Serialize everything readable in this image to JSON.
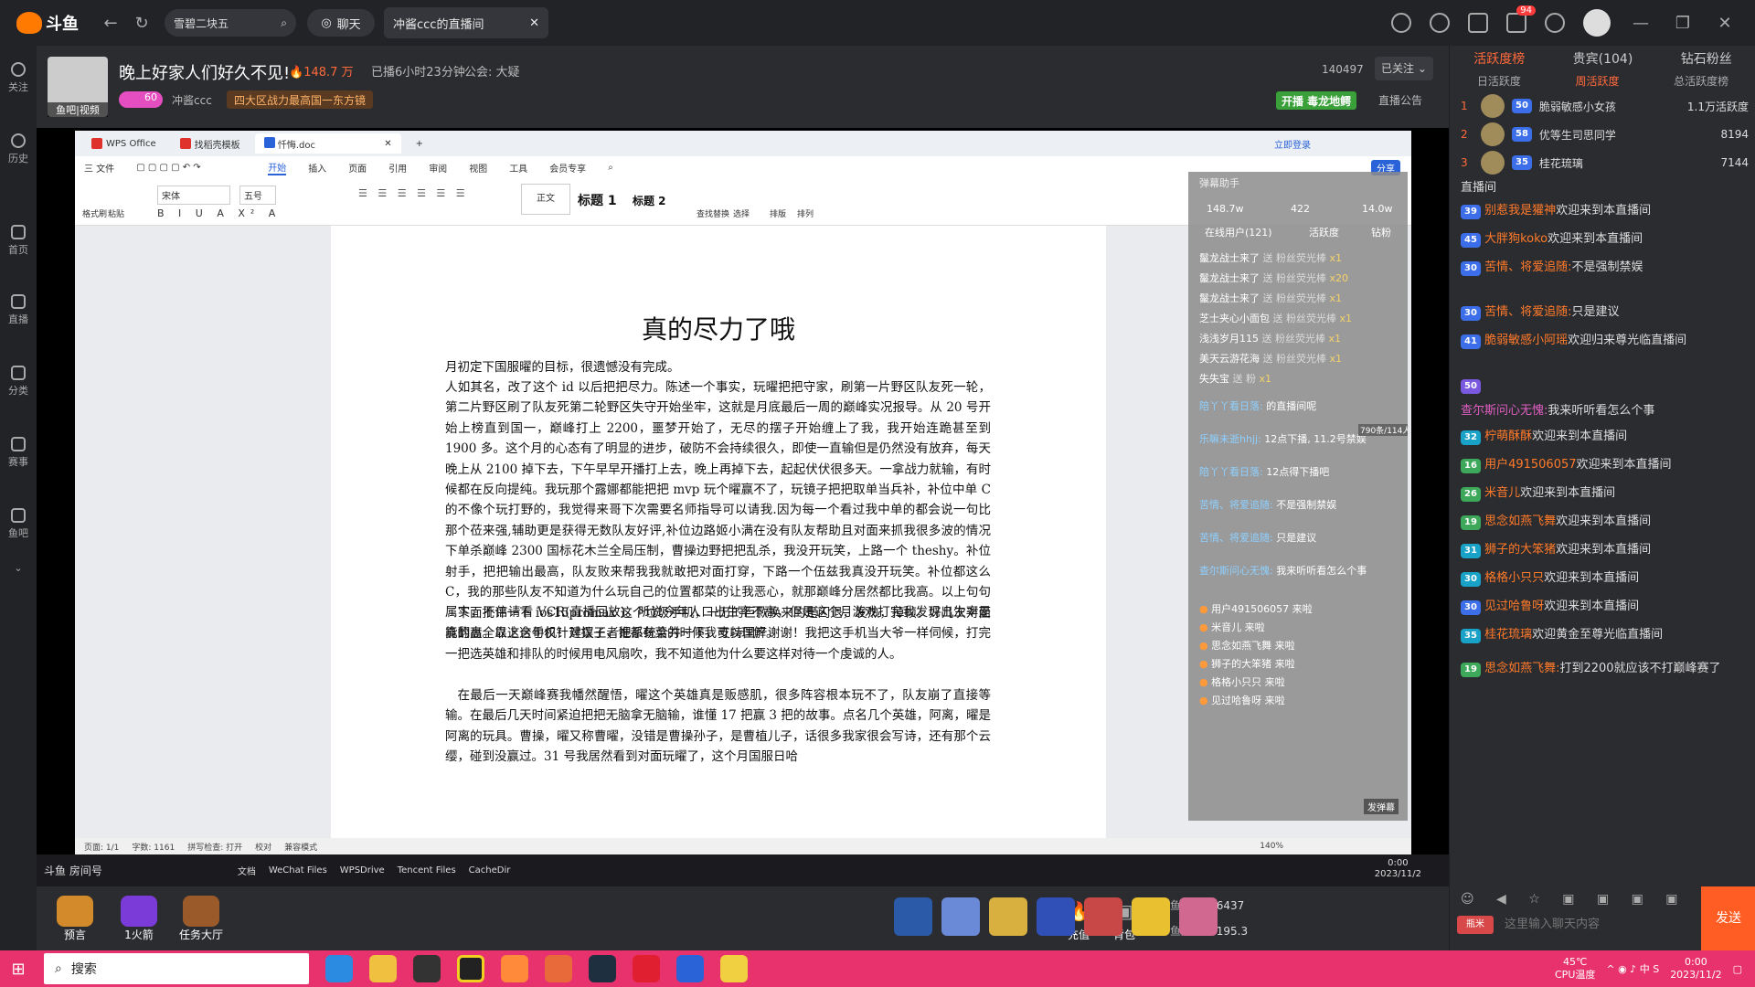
{
  "topbar": {
    "logo": "斗鱼",
    "search_text": "雪碧二块五",
    "chat_label": "聊天",
    "room_tab": "冲酱ccc的直播间",
    "notif_count": "94"
  },
  "sidebar": [
    {
      "label": "关注",
      "icon": "heart-icon"
    },
    {
      "label": "历史",
      "icon": "clock-icon"
    },
    {
      "label": "首页",
      "icon": "home-icon"
    },
    {
      "label": "直播",
      "icon": "tv-icon"
    },
    {
      "label": "分类",
      "icon": "grid-icon"
    },
    {
      "label": "赛事",
      "icon": "trophy-icon"
    },
    {
      "label": "鱼吧",
      "icon": "fishbar-icon"
    }
  ],
  "room": {
    "avatar_tag": "鱼吧|视频",
    "title": "晚上好家人们好久不见!",
    "heat": "148.7 万",
    "uptime": "已播6小时23分钟",
    "guild": "公会: 大疑",
    "fan_level": "60",
    "streamer": "冲酱ccc",
    "rank_banner": "四大区战力最高国一东方镜",
    "viewer_id": "140497",
    "follow_label": "已关注",
    "open_badge": "开播 毒龙地鳄",
    "notice": "直播公告"
  },
  "wps": {
    "tabs": [
      "WPS Office",
      "找稻壳模板",
      "忏悔.doc"
    ],
    "login": "立即登录",
    "share": "分享",
    "menu": [
      "三 文件",
      "开始",
      "插入",
      "页面",
      "引用",
      "审阅",
      "视图",
      "工具",
      "会员专享"
    ],
    "font_name": "宋体",
    "font_size": "五号",
    "styles": [
      "正文",
      "标题 1",
      "标题 2"
    ],
    "tools": [
      "查找替换",
      "选择",
      "排版",
      "排列"
    ],
    "left_tools": [
      "格式刷",
      "粘贴"
    ],
    "doc_title": "真的尽力了哦",
    "paragraphs": [
      "月初定下国服曜的目标，很遗憾没有完成。",
      "人如其名，改了这个 id 以后把把尽力。陈述一个事实，玩曜把把守家，刷第一片野区队友死一轮，第二片野区刷了队友死第二轮野区失守开始坐牢，这就是月底最后一周的巅峰实况报导。从 20 号开始上榜直到国一，巅峰打上 2200，噩梦开始了，无尽的摆子开始缠上了我，我开始连跪甚至到 1900 多。这个月的心态有了明显的进步，破防不会持续很久，即使一直输但是仍然没有放弃，每天晚上从 2100 掉下去，下午早早开播打上去，晚上再掉下去，起起伏伏很多天。一拿战力就输，有时候都在反向提纯。我玩那个露娜都能把把 mvp 玩个曜赢不了，玩镜子把把取单当兵补，补位中单 C 的不像个玩打野的，我觉得来哥下次需要名师指导可以请我.因为每一个看过我中单的都会说一句比那个莅来强,辅助更是获得无数队友好评,补位边路姬小满在没有队友帮助且对面来抓我很多波的情况下单杀巅峰 2300 国标花木兰全局压制，曹操边野把把乱杀，我没开玩笑，上路一个 theshy。补位射手，把把输出最高，队友败来帮我我就敢把对面打穿，下路一个伍兹我真没开玩笑。补位都这么 C，我的那些队友不知道为什么玩自己的位置都菜的让我恶心，就那巅峰分居然都比我高。以上句句属实，不信请看 VCR(直播回放)。听说今年人口出生率不高，但是这个月游戏打完我发现出生率是真的高。以上这句仅针对摆子，谁都有菜的时候我可以理解。",
      "下面批评一下 ios15promax 这个垃圾手机，一万的巨款换来的是闪退，发热，掉帧。好几次对面能翻盘全靠这台手机！建议王者把系统合并一下，支持国产谢谢！我把这手机当大爷一样伺候，打完一把选英雄和排队的时候用电风扇吹，我不知道他为什么要这样对待一个虔诚的人。",
      "在最后一天巅峰赛我幡然醒悟，曜这个英雄真是贩感肌，很多阵容根本玩不了，队友崩了直接等输。在最后几天时间紧迫把把无脑拿无脑输，谁懂 17 把赢 3 把的故事。点名几个英雄，阿离，曜是阿离的玩具。曹操，曜又称曹曜，没错是曹操孙子，是曹植儿子，话很多我家很会写诗，还有那个云缨，碰到没赢过。31 号我居然看到对面玩曜了，这个月国服日哈"
    ],
    "status": [
      "页面: 1/1",
      "字数: 1161",
      "拼写检查: 打开",
      "校对",
      "兼容模式"
    ],
    "zoom": "140%"
  },
  "danmu": {
    "title": "弹幕助手",
    "stats": [
      "148.7w",
      "422",
      "14.0w"
    ],
    "tabs": [
      "在线用户(121)",
      "活跃度",
      "钻粉"
    ],
    "gifts": [
      {
        "name": "鬣龙战士来了",
        "gift": "送 粉丝荧光棒",
        "count": "x1"
      },
      {
        "name": "鬣龙战士来了",
        "gift": "送 粉丝荧光棒",
        "count": "x20"
      },
      {
        "name": "鬣龙战士来了",
        "gift": "送 粉丝荧光棒",
        "count": "x1"
      },
      {
        "name": "芝士夹心小面包",
        "gift": "送 粉丝荧光棒",
        "count": "x1"
      },
      {
        "name": "浅浅岁月115",
        "gift": "送 粉丝荧光棒",
        "count": "x1"
      },
      {
        "name": "美天云游花海",
        "gift": "送 粉丝荧光棒",
        "count": "x1"
      },
      {
        "name": "失失宝",
        "gift": "送 粉",
        "count": "x1"
      }
    ],
    "msgs": [
      {
        "name": "陪丫丫看日落:",
        "text": "的直播间呢"
      },
      {
        "name": "乐嘛未逝hhjj:",
        "text": "12点下播, 11.2号禁娱"
      },
      {
        "name": "陪丫丫看日落:",
        "text": "12点得下播吧"
      },
      {
        "name": "苦情、将爱追随:",
        "text": "不是强制禁娱"
      },
      {
        "name": "苦情、将爱追随:",
        "text": "只是建议"
      },
      {
        "name": "查尔斯问心无愧:",
        "text": "我来听听看怎么个事"
      }
    ],
    "entries": [
      "用户491506057 来啦",
      "米音儿 来啦",
      "思念如燕飞舞 来啦",
      "狮子的大笨猪 来啦",
      "格格小只只 来啦",
      "见过哈鲁呀 来啦"
    ],
    "side_count": "790条/114人",
    "clear": "发弹幕"
  },
  "inner_taskbar": {
    "items": [
      "文档",
      "WeChat Files",
      "WPSDrive",
      "Tencent Files",
      "CacheDir"
    ],
    "time": "0:00",
    "date": "2023/11/2"
  },
  "bottom": {
    "buttons": [
      "预言",
      "1火箭",
      "任务大厅"
    ],
    "charge": "充值",
    "bag": "背包",
    "fishball": "鱼丸",
    "fishball_val": "6437",
    "fishfin": "鱼翅",
    "fishfin_val": "195.3",
    "overlay_room": "斗鱼 房间号"
  },
  "right": {
    "tabs": [
      "活跃度榜",
      "贵宾(104)",
      "钻石粉丝"
    ],
    "subtabs": [
      "日活跃度",
      "周活跃度",
      "总活跃度榜"
    ],
    "ranks": [
      {
        "num": "1",
        "lvl": "50",
        "name": "脆弱敏感小女孩",
        "score": "1.1万活跃度"
      },
      {
        "num": "2",
        "lvl": "58",
        "name": "优等生司思同学",
        "score": "8194"
      },
      {
        "num": "3",
        "lvl": "35",
        "name": "桂花琉璃",
        "score": "7144"
      }
    ],
    "chat": [
      {
        "lvl": "",
        "user": "",
        "text": "直播间"
      },
      {
        "lvl": "39",
        "user": "别惹我是獾神",
        "text": "欢迎来到本直播间"
      },
      {
        "lvl": "45",
        "user": "大胖狗koko",
        "text": "欢迎来到本直播间"
      },
      {
        "lvl": "30",
        "user": "苦情、将爱追随:",
        "text": "不是强制禁娱"
      },
      {
        "lvl": "30",
        "user": "苦情、将爱追随:",
        "text": "只是建议"
      },
      {
        "lvl": "41",
        "user": "脆弱敏感小阿瑶",
        "text": "欢迎归来尊光临直播间"
      },
      {
        "lvl": "50",
        "user": "",
        "text": ""
      },
      {
        "lvl": "",
        "user": "查尔斯问心无愧:",
        "text": "我来听听看怎么个事"
      },
      {
        "lvl": "32",
        "user": "柠萌酥酥",
        "text": "欢迎来到本直播间"
      },
      {
        "lvl": "16",
        "user": "用户491506057",
        "text": "欢迎来到本直播间"
      },
      {
        "lvl": "26",
        "user": "米音儿",
        "text": "欢迎来到本直播间"
      },
      {
        "lvl": "19",
        "user": "思念如燕飞舞",
        "text": "欢迎来到本直播间"
      },
      {
        "lvl": "31",
        "user": "狮子的大笨猪",
        "text": "欢迎来到本直播间"
      },
      {
        "lvl": "30",
        "user": "格格小只只",
        "text": "欢迎来到本直播间"
      },
      {
        "lvl": "30",
        "user": "见过哈鲁呀",
        "text": "欢迎来到本直播间"
      },
      {
        "lvl": "35",
        "user": "桂花琉璃",
        "text": "欢迎黄金至尊光临直播间"
      },
      {
        "lvl": "19",
        "user": "思念如燕飞舞:",
        "text": "打到2200就应该不打巅峰赛了"
      }
    ],
    "input_placeholder": "这里输入聊天内容",
    "send": "发送",
    "shield": "屏蔽",
    "fan_badge": "瓶米"
  },
  "wintaskbar": {
    "search": "搜索",
    "temp": "45℃",
    "temp_label": "CPU温度",
    "time": "0:00",
    "date": "2023/11/2"
  }
}
